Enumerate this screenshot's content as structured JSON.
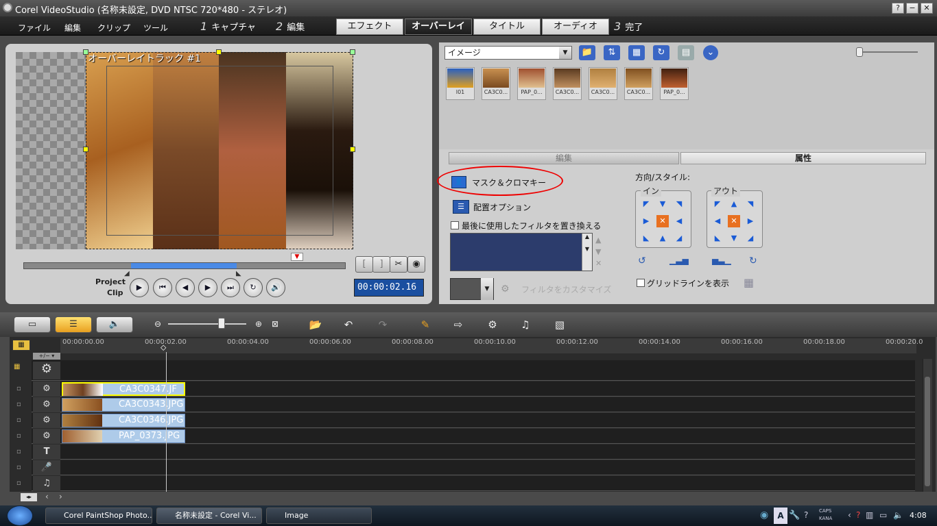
{
  "window": {
    "title": "Corel VideoStudio (名称未設定, DVD NTSC 720*480 - ステレオ)",
    "help": "?",
    "minimize": "−",
    "close": "✕"
  },
  "menu": {
    "file": "ファイル",
    "edit": "編集",
    "clip": "クリップ",
    "tools": "ツール"
  },
  "steps": [
    {
      "num": "1",
      "label": "キャプチャ"
    },
    {
      "num": "2",
      "label": "編集"
    },
    {
      "num": "3",
      "label": "完了"
    }
  ],
  "tabs": [
    "エフェクト",
    "オーバーレイ",
    "タイトル",
    "オーディオ"
  ],
  "active_tab": "オーバーレイ",
  "preview": {
    "overlay_label": "オーバーレイトラック #1",
    "mode_project": "Project",
    "mode_clip": "Clip",
    "timecode": "00:00:02.16"
  },
  "library": {
    "dropdown": "イメージ",
    "thumbnails": [
      "I01",
      "CA3C0...",
      "PAP_0...",
      "CA3C0...",
      "CA3C0...",
      "CA3C0...",
      "PAP_0..."
    ]
  },
  "attributes": {
    "tab_edit": "編集",
    "tab_attr": "属性",
    "mask_chroma": "マスク＆クロマキー",
    "layout_options": "配置オプション",
    "replace_filter": "最後に使用したフィルタを置き換える",
    "customize_filter": "フィルタをカスタマイズ",
    "direction_style": "方向/スタイル:",
    "in_label": "イン",
    "out_label": "アウト",
    "show_grid": "グリッドラインを表示"
  },
  "ruler": [
    "00:00:00.00",
    "00:00:02.00",
    "00:00:04.00",
    "00:00:06.00",
    "00:00:08.00",
    "00:00:10.00",
    "00:00:12.00",
    "00:00:14.00",
    "00:00:16.00",
    "00:00:18.00",
    "00:00:20.0"
  ],
  "clips": [
    "CA3C0347.JF",
    "CA3C0343.JPG",
    "CA3C0346.JPG",
    "PAP_0373.JPG"
  ],
  "taskbar": {
    "items": [
      "Corel PaintShop Photo...",
      "名称未設定 - Corel Vi...",
      "Image"
    ],
    "caps": "CAPS",
    "kana": "KANA",
    "time": "4:08"
  }
}
